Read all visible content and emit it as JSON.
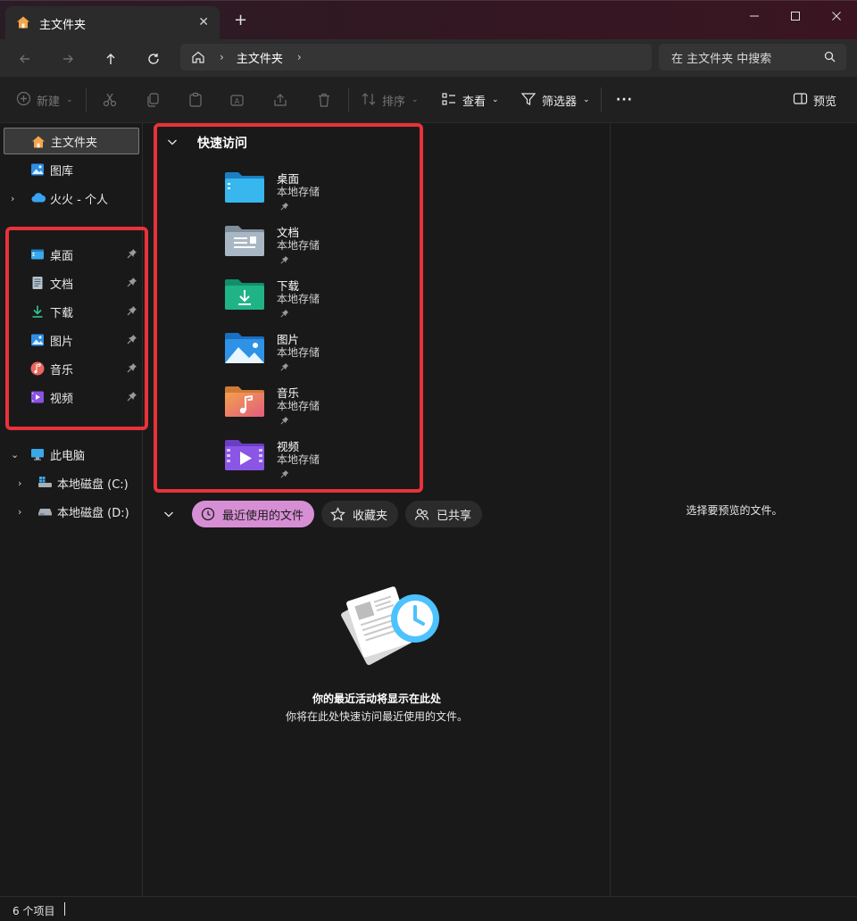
{
  "tab": {
    "title": "主文件夹",
    "close": "✕",
    "new_tab": "+"
  },
  "address": {
    "crumb": "主文件夹",
    "sep": "›"
  },
  "search": {
    "placeholder": "在 主文件夹 中搜索"
  },
  "toolbar": {
    "new_label": "新建",
    "sort_label": "排序",
    "view_label": "查看",
    "filter_label": "筛选器",
    "more_label": "···",
    "preview_label": "预览"
  },
  "sidebar": {
    "top": [
      {
        "label": "主文件夹",
        "icon": "home-icon"
      },
      {
        "label": "图库",
        "icon": "gallery-icon"
      },
      {
        "label": "火火 - 个人",
        "icon": "onedrive-icon"
      }
    ],
    "pinned": [
      {
        "label": "桌面",
        "icon": "desktop-icon"
      },
      {
        "label": "文档",
        "icon": "documents-icon"
      },
      {
        "label": "下载",
        "icon": "downloads-icon"
      },
      {
        "label": "图片",
        "icon": "pictures-icon"
      },
      {
        "label": "音乐",
        "icon": "music-icon"
      },
      {
        "label": "视频",
        "icon": "videos-icon"
      }
    ],
    "this_pc": "此电脑",
    "drives": [
      {
        "label": "本地磁盘 (C:)",
        "icon": "windows-drive-icon"
      },
      {
        "label": "本地磁盘 (D:)",
        "icon": "drive-icon"
      }
    ]
  },
  "quick_access": {
    "title": "快速访问",
    "items": [
      {
        "name": "桌面",
        "sub": "本地存储",
        "icon": "desktop-folder-icon"
      },
      {
        "name": "文档",
        "sub": "本地存储",
        "icon": "documents-folder-icon"
      },
      {
        "name": "下载",
        "sub": "本地存储",
        "icon": "downloads-folder-icon"
      },
      {
        "name": "图片",
        "sub": "本地存储",
        "icon": "pictures-folder-icon"
      },
      {
        "name": "音乐",
        "sub": "本地存储",
        "icon": "music-folder-icon"
      },
      {
        "name": "视频",
        "sub": "本地存储",
        "icon": "videos-folder-icon"
      }
    ]
  },
  "chips": {
    "recent": "最近使用的文件",
    "favorites": "收藏夹",
    "shared": "已共享"
  },
  "empty": {
    "title": "你的最近活动将显示在此处",
    "subtitle": "你将在此处快速访问最近使用的文件。"
  },
  "preview": {
    "text": "选择要预览的文件。"
  },
  "status": {
    "count": "6 个项目"
  },
  "colors": {
    "highlight": "#e8323a",
    "chip_active": "#d68fd4",
    "accent": "#4cc2ff"
  }
}
